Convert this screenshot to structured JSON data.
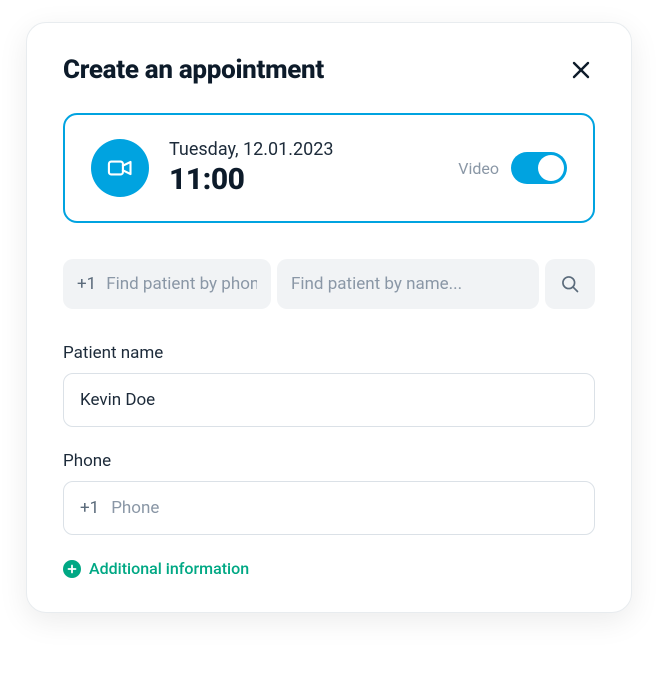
{
  "header": {
    "title": "Create an appointment"
  },
  "datetime": {
    "date": "Tuesday, 12.01.2023",
    "time": "11:00",
    "toggle_label": "Video"
  },
  "search": {
    "phone_prefix": "+1",
    "phone_placeholder": "Find patient by phone",
    "name_placeholder": "Find patient by name..."
  },
  "fields": {
    "patient_name_label": "Patient name",
    "patient_name_value": "Kevin Doe",
    "phone_label": "Phone",
    "phone_prefix": "+1",
    "phone_placeholder": "Phone",
    "phone_value": ""
  },
  "additional_label": "Additional information"
}
